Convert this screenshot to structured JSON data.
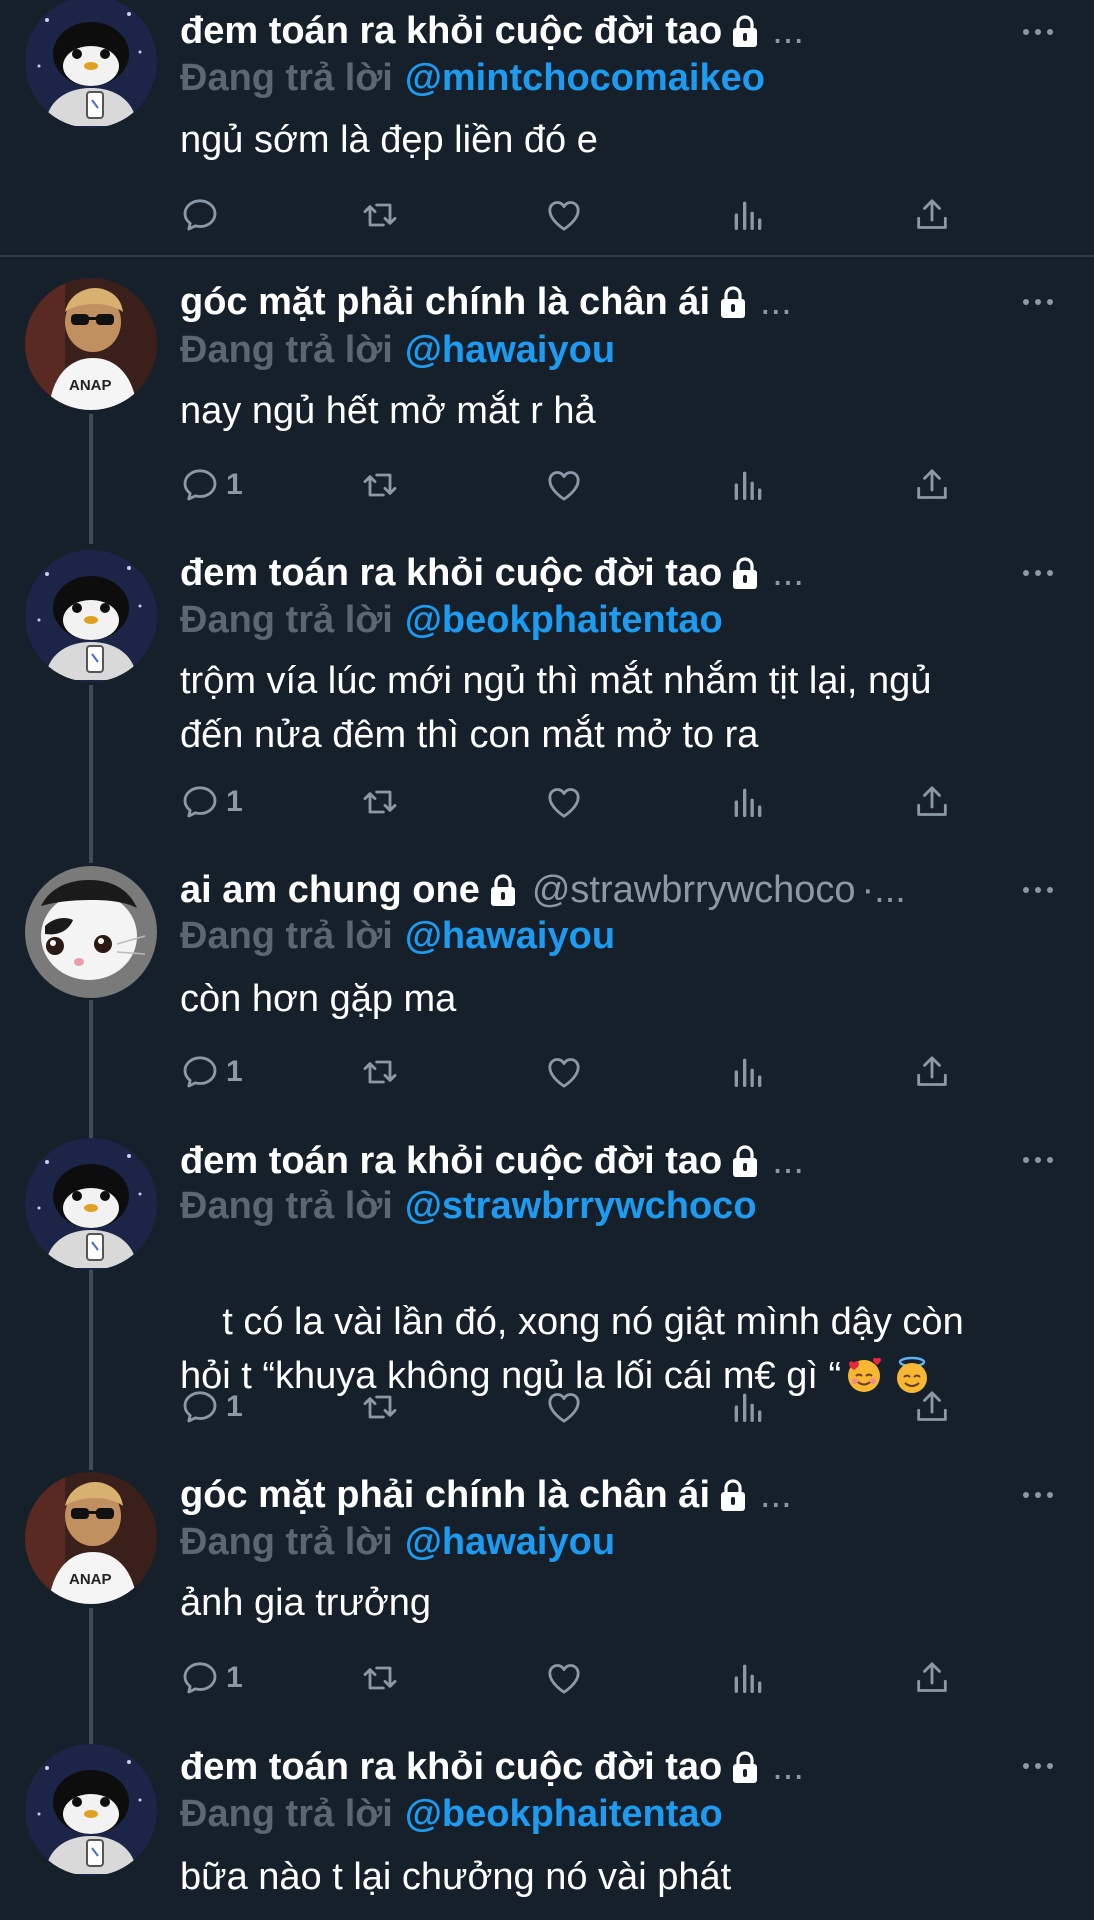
{
  "theme": {
    "background": "#15202b",
    "link": "#1d9bf0",
    "muted": "#8b98a5",
    "reply_prefix": "#5b6670"
  },
  "tweets": [
    {
      "name": "đem toán ra khỏi cuộc đời tao",
      "handle": "",
      "ellipsis": "...",
      "reply_prefix": "Đang trả lời",
      "reply_to": "@mintchocomaikeo",
      "text": "ngủ sớm là đẹp liền đó e",
      "reply_count": "",
      "avatar": "penguin-avatar"
    },
    {
      "name": "góc mặt phải chính là chân ái",
      "handle": "",
      "ellipsis": "...",
      "reply_prefix": "Đang trả lời",
      "reply_to": "@hawaiyou",
      "text": "nay ngủ hết mở mắt r hả",
      "reply_count": "1",
      "avatar": "child-sunglasses-avatar"
    },
    {
      "name": "đem toán ra khỏi cuộc đời tao",
      "handle": "",
      "ellipsis": "...",
      "reply_prefix": "Đang trả lời",
      "reply_to": "@beokphaitentao",
      "text": "trộm vía lúc mới ngủ thì mắt nhắm tịt lại, ngủ\nđến nửa đêm thì con mắt mở to ra",
      "reply_count": "1",
      "avatar": "penguin-avatar"
    },
    {
      "name": "ai am chung one",
      "handle": "@strawbrrywchoco",
      "ellipsis": "·...",
      "reply_prefix": "Đang trả lời",
      "reply_to": "@hawaiyou",
      "text": "còn hơn gặp ma",
      "reply_count": "1",
      "avatar": "cat-avatar"
    },
    {
      "name": "đem toán ra khỏi cuộc đời tao",
      "handle": "",
      "ellipsis": "...",
      "reply_prefix": "Đang trả lời",
      "reply_to": "@strawbrrywchoco",
      "text": "t có la vài lần đó, xong nó giật mình dậy còn\nhỏi t “khuya không ngủ la lối cái m€ gì “",
      "reply_count": "1",
      "avatar": "penguin-avatar",
      "emojis": [
        "smiling-face-with-hearts-emoji",
        "smiling-face-with-halo-emoji"
      ]
    },
    {
      "name": "góc mặt phải chính là chân ái",
      "handle": "",
      "ellipsis": "...",
      "reply_prefix": "Đang trả lời",
      "reply_to": "@hawaiyou",
      "text": "ảnh gia trưởng",
      "reply_count": "1",
      "avatar": "child-sunglasses-avatar"
    },
    {
      "name": "đem toán ra khỏi cuộc đời tao",
      "handle": "",
      "ellipsis": "...",
      "reply_prefix": "Đang trả lời",
      "reply_to": "@beokphaitentao",
      "text": "bữa nào t lại chưởng nó vài phát",
      "reply_count": "",
      "avatar": "penguin-avatar"
    }
  ]
}
